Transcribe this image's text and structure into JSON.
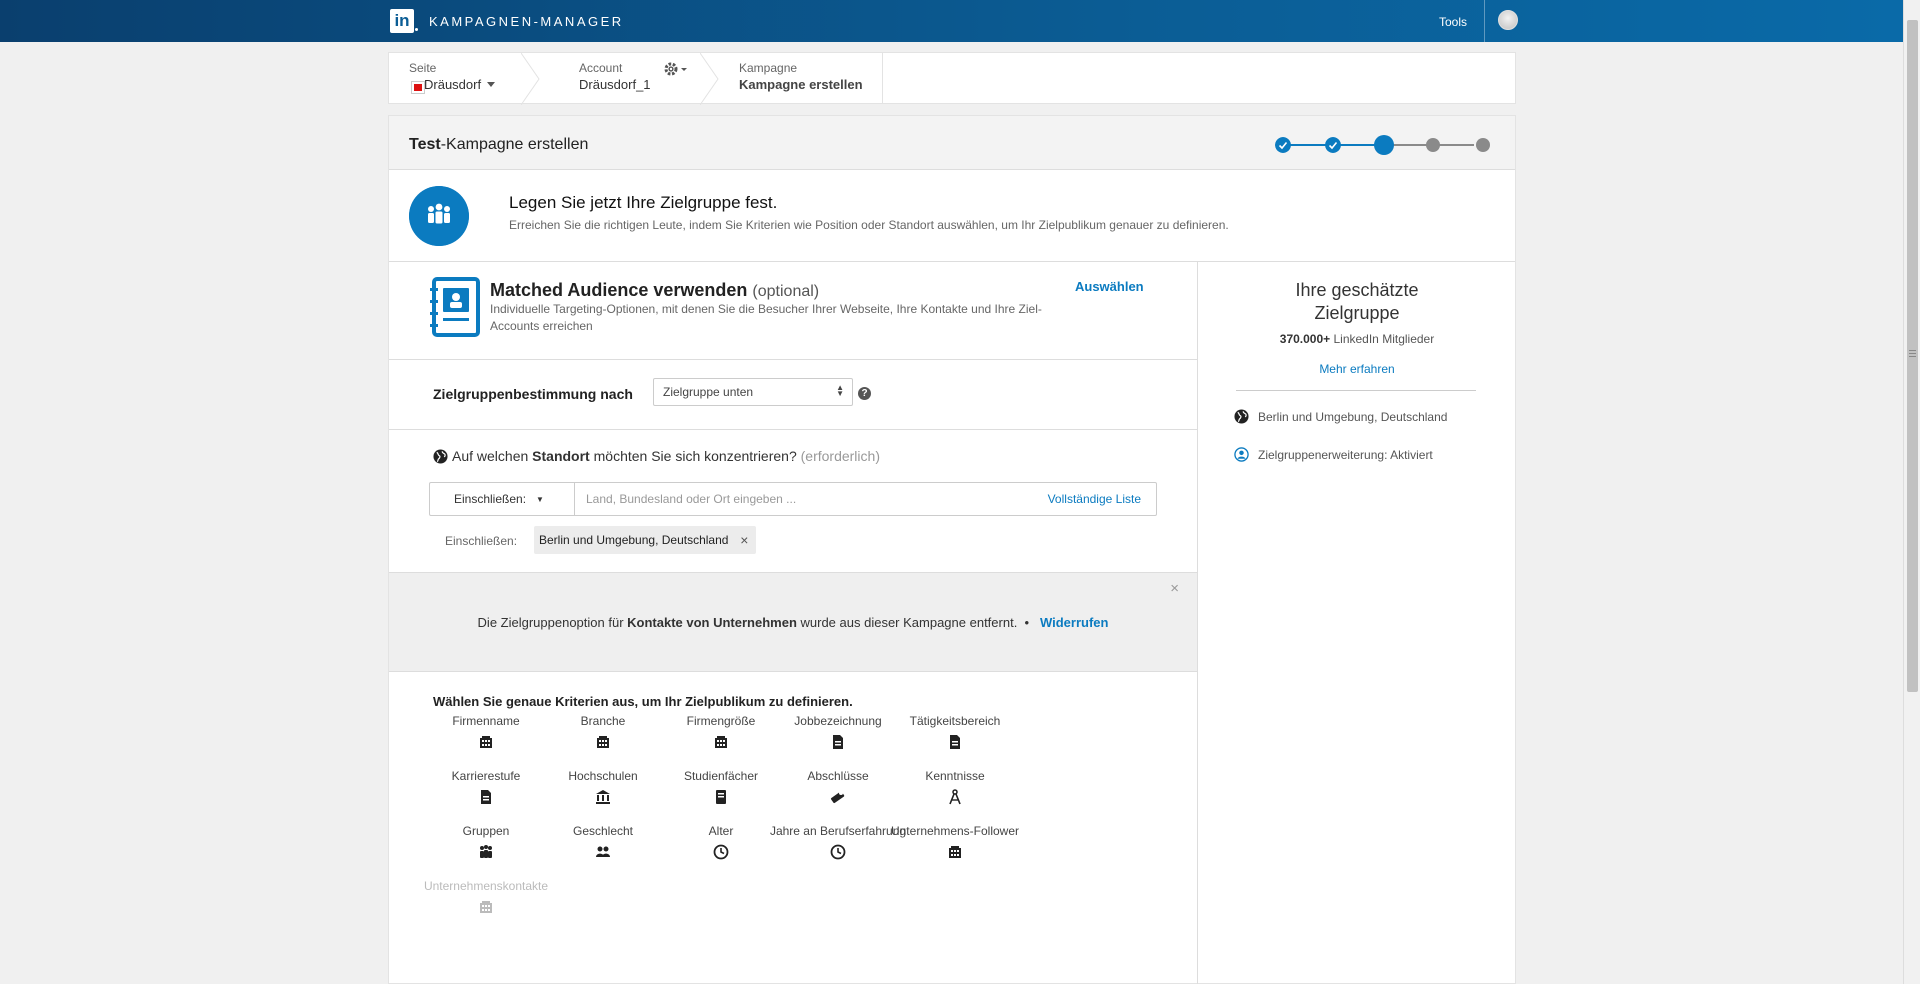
{
  "header": {
    "logo_text": "in",
    "app_title": "KAMPAGNEN-MANAGER",
    "tools_label": "Tools"
  },
  "breadcrumb": {
    "page": {
      "label": "Seite",
      "value": "Dräusdorf"
    },
    "account": {
      "label": "Account",
      "value": "Dräusdorf_1"
    },
    "campaign": {
      "label": "Kampagne",
      "value": "Kampagne erstellen"
    }
  },
  "campaign": {
    "title_bold": "Test",
    "title_rest": "-Kampagne erstellen",
    "steps_total": 5,
    "current_step": 3
  },
  "intro": {
    "title": "Legen Sie jetzt Ihre Zielgruppe fest.",
    "subtitle": "Erreichen Sie die richtigen Leute, indem Sie Kriterien wie Position oder Standort auswählen, um Ihr Zielpublikum genauer zu definieren."
  },
  "matched": {
    "title": "Matched Audience verwenden",
    "optional": "(optional)",
    "description": "Individuelle Targeting-Optionen, mit denen Sie die Besucher Ihrer Webseite, Ihre Kontakte und Ihre Ziel-Accounts erreichen",
    "select_label": "Auswählen"
  },
  "targeting": {
    "label": "Zielgruppenbestimmung nach",
    "selected": "Zielgruppe unten",
    "help": "?"
  },
  "location": {
    "q_prefix": "Auf welchen ",
    "q_bold": "Standort",
    "q_suffix": " möchten Sie sich konzentrieren?",
    "required": "(erforderlich)",
    "include_mode": "Einschließen:",
    "placeholder": "Land, Bundesland oder Ort eingeben ...",
    "full_list": "Vollständige Liste",
    "included_label": "Einschließen:",
    "included_chip": "Berlin und Umgebung, Deutschland",
    "chip_remove": "×"
  },
  "notice": {
    "prefix": "Die Zielgruppenoption für ",
    "bold": "Kontakte von Unternehmen",
    "suffix": " wurde aus dieser Kampagne entfernt.",
    "bullet": "•",
    "undo": "Widerrufen",
    "close": "×"
  },
  "criteria": {
    "title": "Wählen Sie genaue Kriterien aus, um Ihr Zielpublikum zu definieren.",
    "items": [
      {
        "label": "Firmenname",
        "icon": "building-icon"
      },
      {
        "label": "Branche",
        "icon": "building-icon"
      },
      {
        "label": "Firmengröße",
        "icon": "building-icon"
      },
      {
        "label": "Jobbezeichnung",
        "icon": "document-icon"
      },
      {
        "label": "Tätigkeitsbereich",
        "icon": "document-icon"
      },
      {
        "label": "Karrierestufe",
        "icon": "document-icon"
      },
      {
        "label": "Hochschulen",
        "icon": "institution-icon"
      },
      {
        "label": "Studienfächer",
        "icon": "book-icon"
      },
      {
        "label": "Abschlüsse",
        "icon": "diploma-icon"
      },
      {
        "label": "Kenntnisse",
        "icon": "compass-icon"
      },
      {
        "label": "Gruppen",
        "icon": "group-icon"
      },
      {
        "label": "Geschlecht",
        "icon": "people-icon"
      },
      {
        "label": "Alter",
        "icon": "clock-icon"
      },
      {
        "label": "Jahre an Berufserfahrung",
        "icon": "clock-icon"
      },
      {
        "label": "Unternehmens-Follower",
        "icon": "building-icon"
      },
      {
        "label": "Unternehmenskontakte",
        "icon": "building-icon",
        "disabled": true
      }
    ]
  },
  "estimate": {
    "title_line1": "Ihre geschätzte",
    "title_line2": "Zielgruppe",
    "count": "370.000+",
    "count_suffix": " LinkedIn Mitglieder",
    "more": "Mehr erfahren",
    "location": "Berlin und Umgebung, Deutschland",
    "expansion_label": "Zielgruppenerweiterung:",
    "expansion_value": "Aktiviert"
  },
  "colors": {
    "brand": "#0b5d95",
    "accent": "#0b7bc0",
    "step_done": "#0b7bc0",
    "step_todo": "#8a8a8a"
  }
}
